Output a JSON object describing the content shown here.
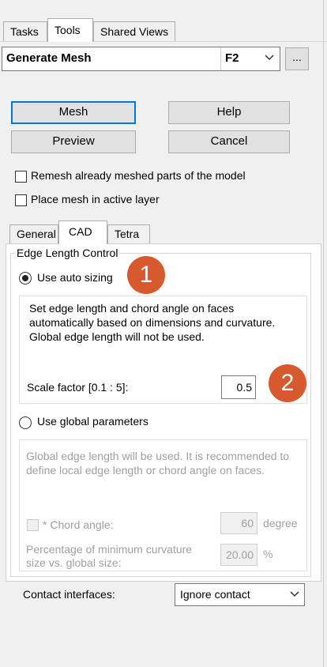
{
  "tabs": [
    "Tasks",
    "Tools",
    "Shared Views"
  ],
  "command": {
    "name": "Generate Mesh",
    "shortcut": "F2",
    "more_label": "..."
  },
  "buttons": {
    "mesh": "Mesh",
    "help": "Help",
    "preview": "Preview",
    "cancel": "Cancel"
  },
  "options": {
    "remesh": "Remesh already meshed parts of the model",
    "place_layer": "Place mesh in active layer"
  },
  "subtabs": [
    "General",
    "CAD",
    "Tetra"
  ],
  "edge_length": {
    "title": "Edge Length Control",
    "auto_label": "Use auto sizing",
    "auto_desc": [
      "Set edge length and chord angle on faces",
      "automatically based on dimensions and curvature.",
      "Global edge length will not be used."
    ],
    "scale_label": "Scale factor [0.1 : 5]:",
    "scale_value": "0.5",
    "global_label": "Use global parameters",
    "global_desc": [
      "Global edge length will be used. It is recommended to",
      "define local edge length or chord angle on faces."
    ],
    "chord_label": "* Chord angle:",
    "chord_value": "60",
    "chord_unit": "degree",
    "curv_label": [
      "Percentage of minimum curvature",
      "size vs. global size:"
    ],
    "curv_value": "20.00",
    "curv_unit": "%"
  },
  "contact": {
    "label": "Contact interfaces:",
    "value": "Ignore contact"
  },
  "markers": [
    "1",
    "2"
  ],
  "colors": {
    "marker": "#d65a2e",
    "focus": "#0078d7"
  }
}
